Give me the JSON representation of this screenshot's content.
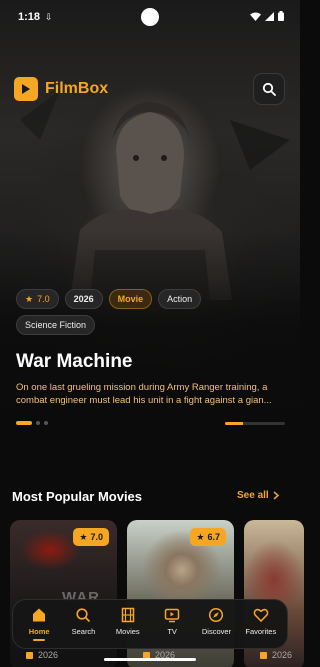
{
  "status_bar": {
    "time": "1:18"
  },
  "app": {
    "name": "FilmBox"
  },
  "featured": {
    "rating": "7.0",
    "year": "2026",
    "genres": [
      "Movie",
      "Action",
      "Science Fiction"
    ],
    "title": "War Machine",
    "description": "On one last grueling mission during Army Ranger training, a combat engineer must lead his unit in a fight against a gian...",
    "carousel_index": 0,
    "carousel_count": 3,
    "progress": 0.3
  },
  "section": {
    "title": "Most Popular Movies",
    "see_all": "See all"
  },
  "posters": [
    {
      "rating": "7.0",
      "year": "2026",
      "title_art": "WAR"
    },
    {
      "rating": "6.7",
      "year": "2026"
    },
    {
      "year": "2026"
    }
  ],
  "nav": [
    {
      "label": "Home",
      "icon": "home-icon",
      "active": true
    },
    {
      "label": "Search",
      "icon": "search-icon"
    },
    {
      "label": "Movies",
      "icon": "film-icon"
    },
    {
      "label": "TV",
      "icon": "tv-icon"
    },
    {
      "label": "Discover",
      "icon": "compass-icon"
    },
    {
      "label": "Favorites",
      "icon": "heart-icon"
    }
  ],
  "colors": {
    "accent": "#f5a623",
    "background": "#0b0b0b"
  }
}
